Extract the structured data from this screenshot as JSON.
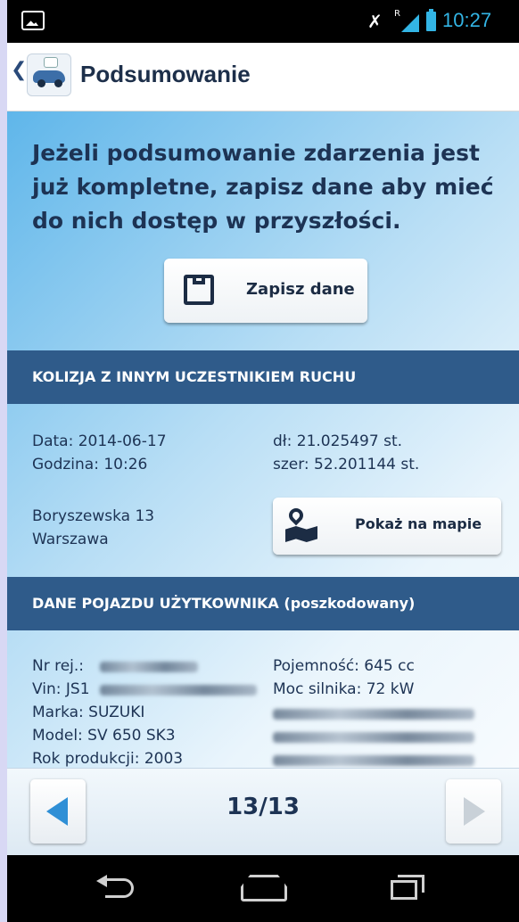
{
  "status_bar": {
    "time": "10:27",
    "icons": [
      "image-icon",
      "mute-icon",
      "signal-icon",
      "battery-icon"
    ]
  },
  "action_bar": {
    "back_glyph": "❮",
    "title": "Podsumowanie",
    "logo_icon": "car-accident-logo-icon"
  },
  "intro_text": "Jeżeli podsumowanie zdarzenia jest już kompletne, zapisz dane aby mieć do nich dostęp w przyszłości.",
  "save_button": {
    "label": "Zapisz dane",
    "icon": "floppy-disk-icon"
  },
  "section_collision": {
    "header": "KOLIZJA Z INNYM UCZESTNIKIEM RUCHU",
    "date": "Data: 2014-06-17",
    "time": "Godzina: 10:26",
    "longitude": "dł: 21.025497 st.",
    "latitude": "szer: 52.201144 st.",
    "street": "Boryszewska 13",
    "city": "Warszawa",
    "map_button": {
      "label": "Pokaż na mapie",
      "icon": "map-pin-icon"
    }
  },
  "section_vehicle": {
    "header": "DANE POJAZDU UŻYTKOWNIKA (poszkodowany)",
    "reg_label": "Nr rej.:",
    "vin_label": "Vin: JS1",
    "make": "Marka: SUZUKI",
    "model": "Model: SV 650 SK3",
    "year": "Rok produkcji: 2003",
    "capacity": "Pojemność: 645 cc",
    "power": "Moc silnika: 72 kW"
  },
  "pager": {
    "text": "13/13"
  },
  "system_nav": {
    "icons": [
      "back-icon",
      "home-icon",
      "recent-apps-icon"
    ]
  },
  "colors": {
    "header_bg": "#2f5b8a",
    "text_dark": "#1d3354",
    "accent_blue": "#2f8fd6"
  }
}
